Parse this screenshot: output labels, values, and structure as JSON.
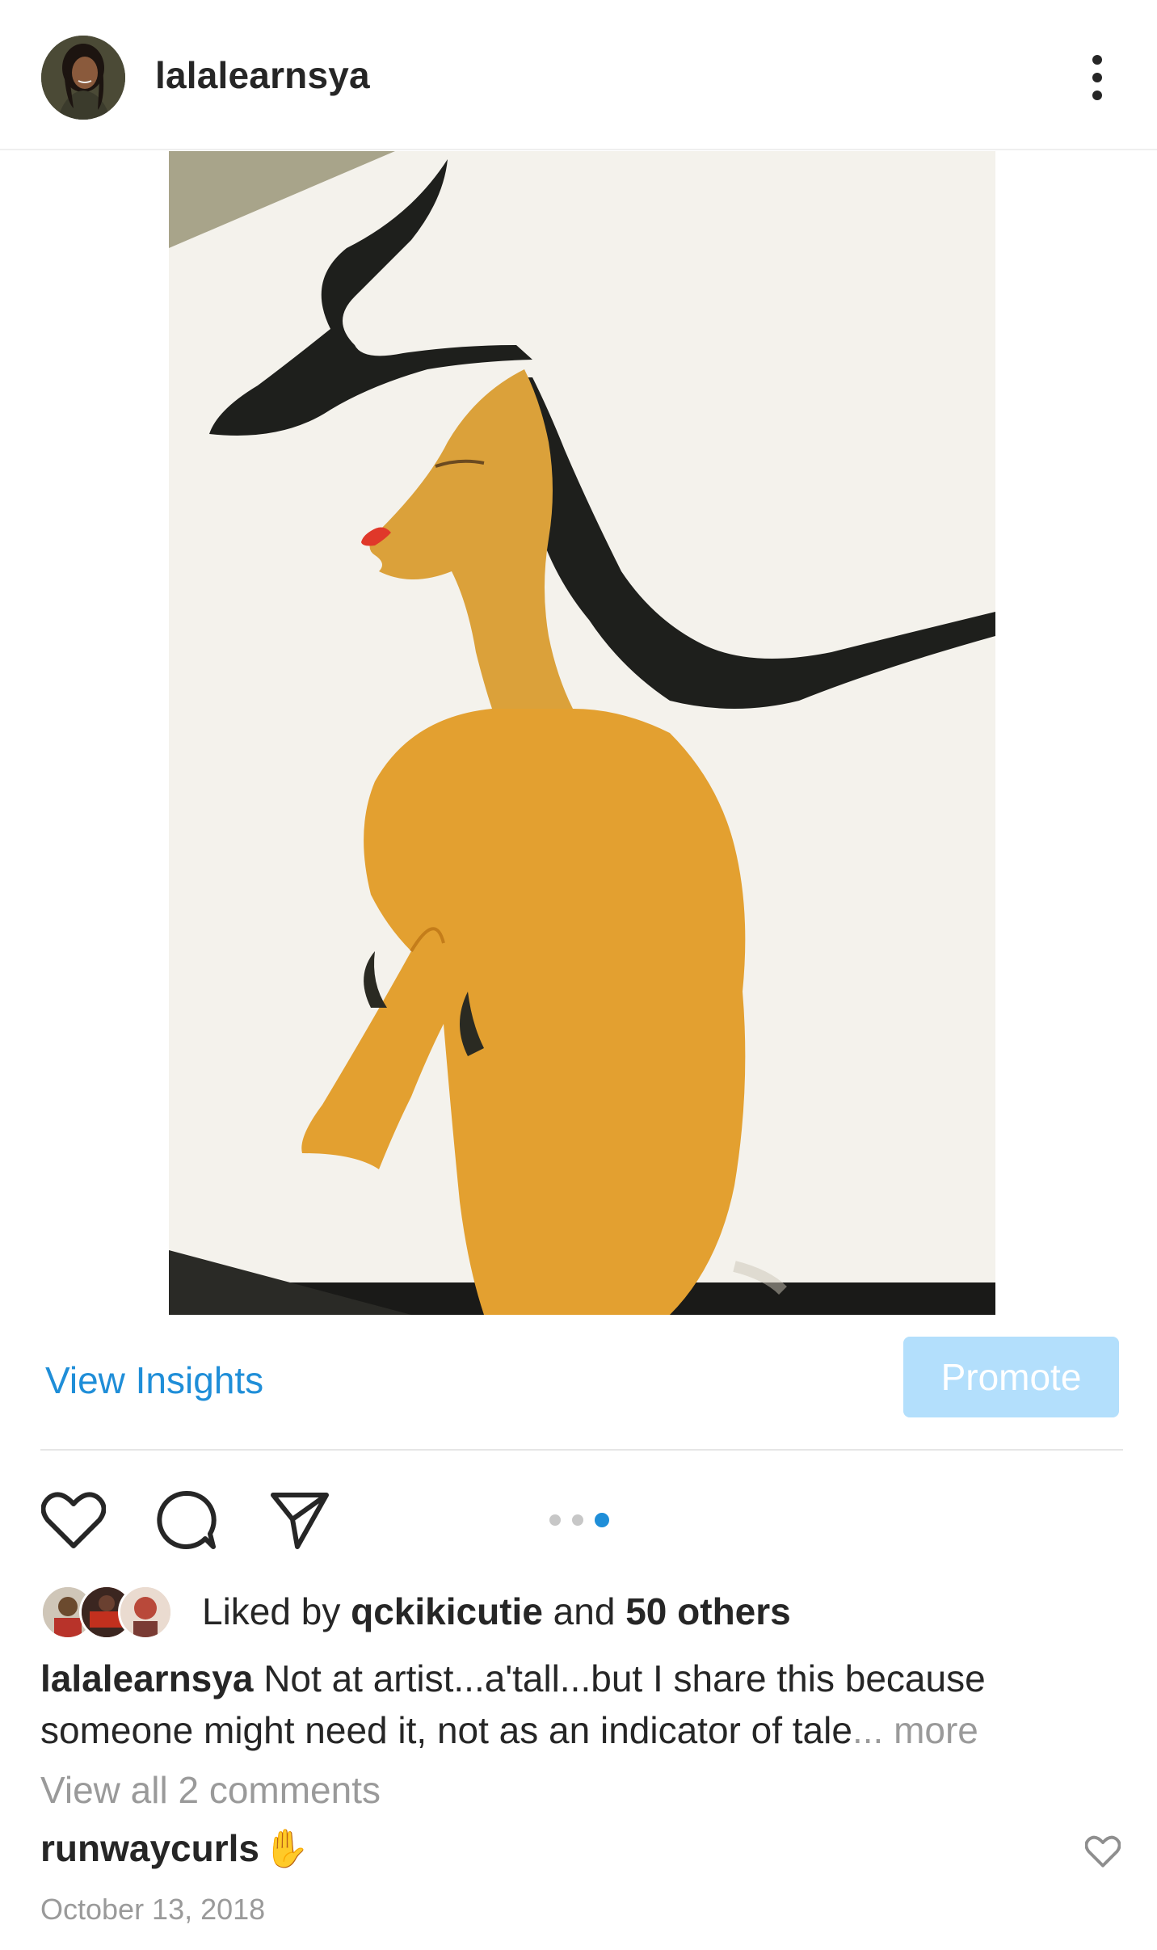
{
  "header": {
    "username": "lalalearnsya",
    "more_icon": "more-vertical-icon"
  },
  "actions": {
    "view_insights": "View Insights",
    "promote": "Promote",
    "carousel": {
      "total": 3,
      "active_index": 2
    },
    "accent_color": "#1f8ed8",
    "promote_color": "#b3dffc"
  },
  "likes": {
    "prefix": "Liked by ",
    "first_user": "qckikicutie",
    "connector": " and ",
    "others": "50 others"
  },
  "caption": {
    "username": "lalalearnsya",
    "text": " Not at artist...a'tall...but I share this because someone might need it, not as an indicator of tale",
    "ellipsis": "...",
    "more": " more"
  },
  "comments": {
    "view_all": "View all 2 comments",
    "items": [
      {
        "username": "runwaycurls",
        "text": "✋"
      }
    ]
  },
  "date": "October 13, 2018"
}
